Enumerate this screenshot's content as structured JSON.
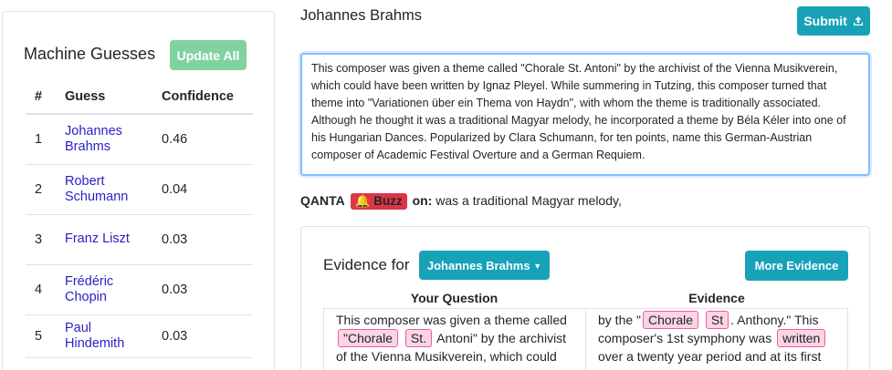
{
  "sidebar": {
    "title": "Machine Guesses",
    "update_label": "Update All",
    "columns": [
      "#",
      "Guess",
      "Confidence"
    ],
    "rows": [
      {
        "num": "1",
        "guess_line1": "Johannes",
        "guess_line2": "Brahms",
        "confidence": "0.46"
      },
      {
        "num": "2",
        "guess_line1": "Robert",
        "guess_line2": "Schumann",
        "confidence": "0.04"
      },
      {
        "num": "3",
        "guess_line1": "Franz Liszt",
        "guess_line2": "",
        "confidence": "0.03"
      },
      {
        "num": "4",
        "guess_line1": "Frédéric",
        "guess_line2": "Chopin",
        "confidence": "0.03"
      },
      {
        "num": "5",
        "guess_line1": "Paul",
        "guess_line2": "Hindemith",
        "confidence": "0.03"
      }
    ]
  },
  "main": {
    "answer": "Johannes Brahms",
    "submit_label": "Submit",
    "question_text": "This composer was given a theme called \"Chorale St. Antoni\" by the archivist of the Vienna Musikverein, which could have been written by Ignaz Pleyel.  While summering in Tutzing, this composer turned that theme into \"Variationen über ein Thema von Haydn\", with whom the theme is traditionally associated.  Although he thought it was a traditional Magyar melody, he incorporated a theme by Béla Kéler into one of his Hungarian Dances.  Popularized by Clara Schumann, for ten points, name this German-Austrian composer of Academic Festival Overture and a German Requiem.",
    "qanta": {
      "label": "QANTA",
      "buzz": "Buzz",
      "on": "on:",
      "phrase": "was a traditional Magyar melody,"
    }
  },
  "evidence": {
    "label": "Evidence for",
    "dropdown_value": "Johannes Brahms",
    "more_label": "More Evidence",
    "col_question": "Your Question",
    "col_evidence": "Evidence",
    "question_snippet": {
      "t1": "This composer was given a theme called",
      "h1": "\"Chorale",
      "h2": "St.",
      "t2": "Antoni\" by the archivist of the Vienna Musikverein, which could have been"
    },
    "evidence_snippet": {
      "t1": "by the \"",
      "h1": "Chorale",
      "h2": "St",
      "t2": ". Anthony.\" This composer's 1st symphony was",
      "h3": "written",
      "t3": "over a twenty year period and at its first"
    }
  }
}
